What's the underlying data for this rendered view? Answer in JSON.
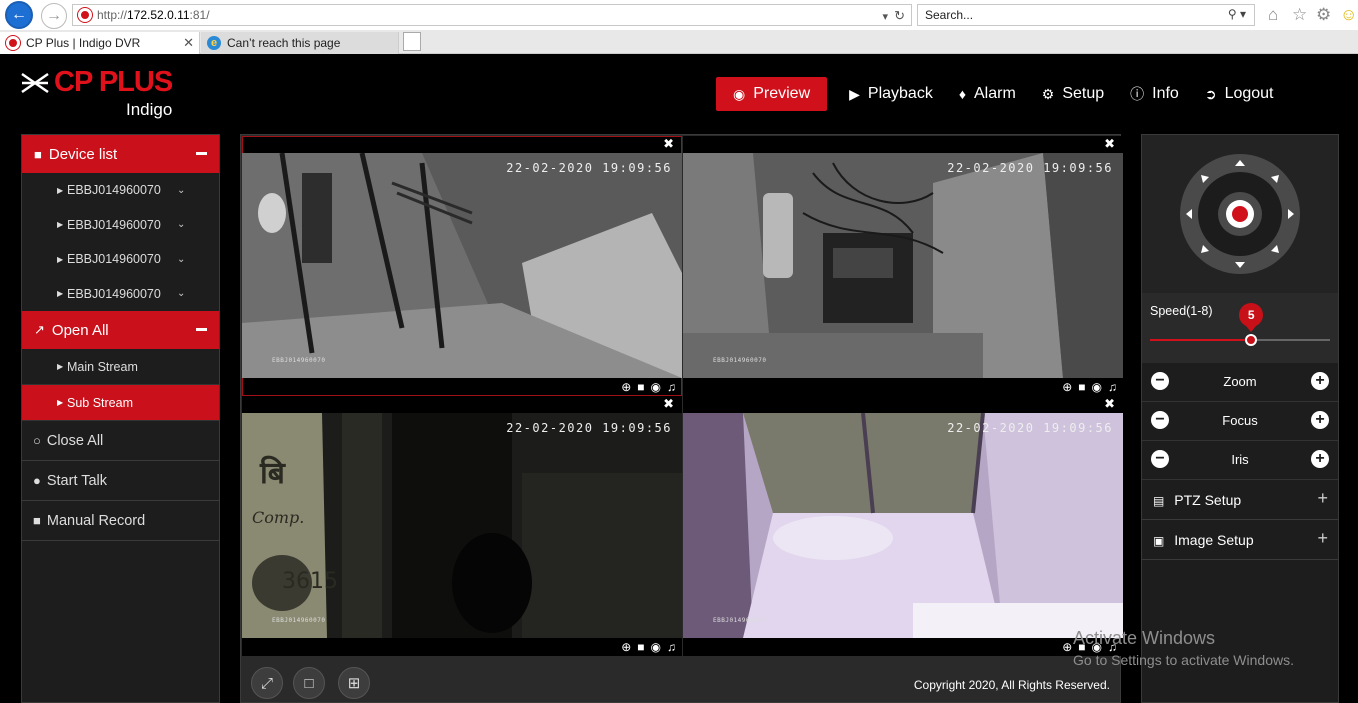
{
  "browser": {
    "url_prefix": "http://",
    "url_host": "172.52.0.11",
    "url_rest": ":81/",
    "search_placeholder": "Search...",
    "tabs": [
      {
        "title": "CP Plus | Indigo DVR",
        "icon": "cp-plus-favicon"
      },
      {
        "title": "Can’t reach this page",
        "icon": "ie-favicon"
      }
    ]
  },
  "logo": {
    "brand": "CP PLUS",
    "sub": "Indigo"
  },
  "nav": {
    "preview": "Preview",
    "playback": "Playback",
    "alarm": "Alarm",
    "setup": "Setup",
    "info": "Info",
    "logout": "Logout"
  },
  "sidebar": {
    "device_list": "Device list",
    "devices": [
      "EBBJ014960070",
      "EBBJ014960070",
      "EBBJ014960070",
      "EBBJ014960070"
    ],
    "open_all": "Open All",
    "main_stream": "Main Stream",
    "sub_stream": "Sub Stream",
    "close_all": "Close All",
    "start_talk": "Start Talk",
    "manual_record": "Manual Record"
  },
  "cameras": [
    {
      "timestamp": "22-02-2020 19:09:56",
      "device_id": "EBBJ014960070"
    },
    {
      "timestamp": "22-02-2020 19:09:56",
      "device_id": "EBBJ014960070"
    },
    {
      "timestamp": "22-02-2020 19:09:56",
      "device_id": "EBBJ014960070"
    },
    {
      "timestamp": "22-02-2020 19:09:56",
      "device_id": "EBBJ014960070"
    }
  ],
  "footer": {
    "copyright": "Copyright 2020, All Rights Reserved."
  },
  "ptz": {
    "speed_label": "Speed(1-8)",
    "speed_value": "5",
    "speed_min": 1,
    "speed_max": 8,
    "zoom": "Zoom",
    "focus": "Focus",
    "iris": "Iris",
    "ptz_setup": "PTZ Setup",
    "image_setup": "Image Setup"
  },
  "watermark": {
    "line1": "Activate Windows",
    "line2": "Go to Settings to activate Windows."
  },
  "colors": {
    "accent": "#d0111c",
    "panel": "#1d1d1d",
    "background": "#000000"
  }
}
